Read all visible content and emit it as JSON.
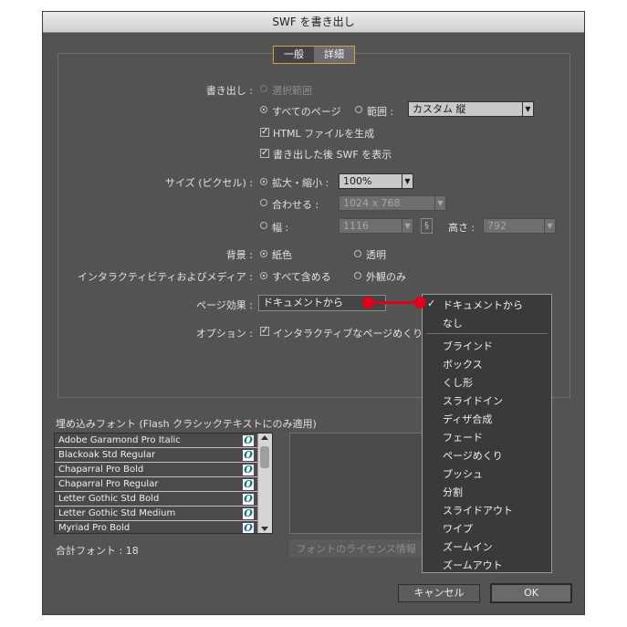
{
  "dialog": {
    "title": "SWF を書き出し"
  },
  "tabs": [
    "一般",
    "詳細"
  ],
  "export": {
    "label": "書き出し :",
    "selection": "選択範囲",
    "all_pages": "すべてのページ",
    "range": "範囲 :",
    "range_value": "カスタム 縦",
    "html_check": "HTML ファイルを生成",
    "view_check": "書き出した後 SWF を表示"
  },
  "size": {
    "label": "サイズ (ピクセル) :",
    "scale": "拡大・縮小 :",
    "scale_value": "100%",
    "fit": "合わせる :",
    "fit_value": "1024 x 768",
    "width": "幅 :",
    "width_value": "1116",
    "height": "高さ :",
    "height_value": "792"
  },
  "background": {
    "label": "背景 :",
    "paper": "紙色",
    "transparent": "透明"
  },
  "interactive": {
    "label": "インタラクティビティおよびメディア :",
    "include_all": "すべて含める",
    "appearance_only": "外観のみ"
  },
  "page_effect": {
    "label": "ページ効果 :",
    "value": "ドキュメントから",
    "options": [
      "ドキュメントから",
      "なし",
      "ブラインド",
      "ボックス",
      "くし形",
      "スライドイン",
      "ディザ合成",
      "フェード",
      "ページめくり",
      "プッシュ",
      "分割",
      "スライドアウト",
      "ワイプ",
      "ズームイン",
      "ズームアウト"
    ],
    "checkmark": "✓"
  },
  "options": {
    "label": "オプション :",
    "interactive_page_curl": "インタラクティブなページめくり"
  },
  "embedded_fonts": {
    "heading": "埋め込みフォント (Flash クラシックテキストにのみ適用)",
    "fonts": [
      "Adobe Garamond Pro Italic",
      "Blackoak Std Regular",
      "Chaparral Pro Bold",
      "Chaparral Pro Regular",
      "Letter Gothic Std Bold",
      "Letter Gothic Std Medium",
      "Myriad Pro Bold"
    ],
    "font_icon": "O",
    "total": "合計フォント : 18",
    "license_button": "フォントのライセンス情報"
  },
  "buttons": {
    "cancel": "キャンセル",
    "ok": "OK"
  },
  "colors": {
    "accent": "#d3a14d",
    "annotation": "#e0001b",
    "dialog_bg": "#535353"
  }
}
